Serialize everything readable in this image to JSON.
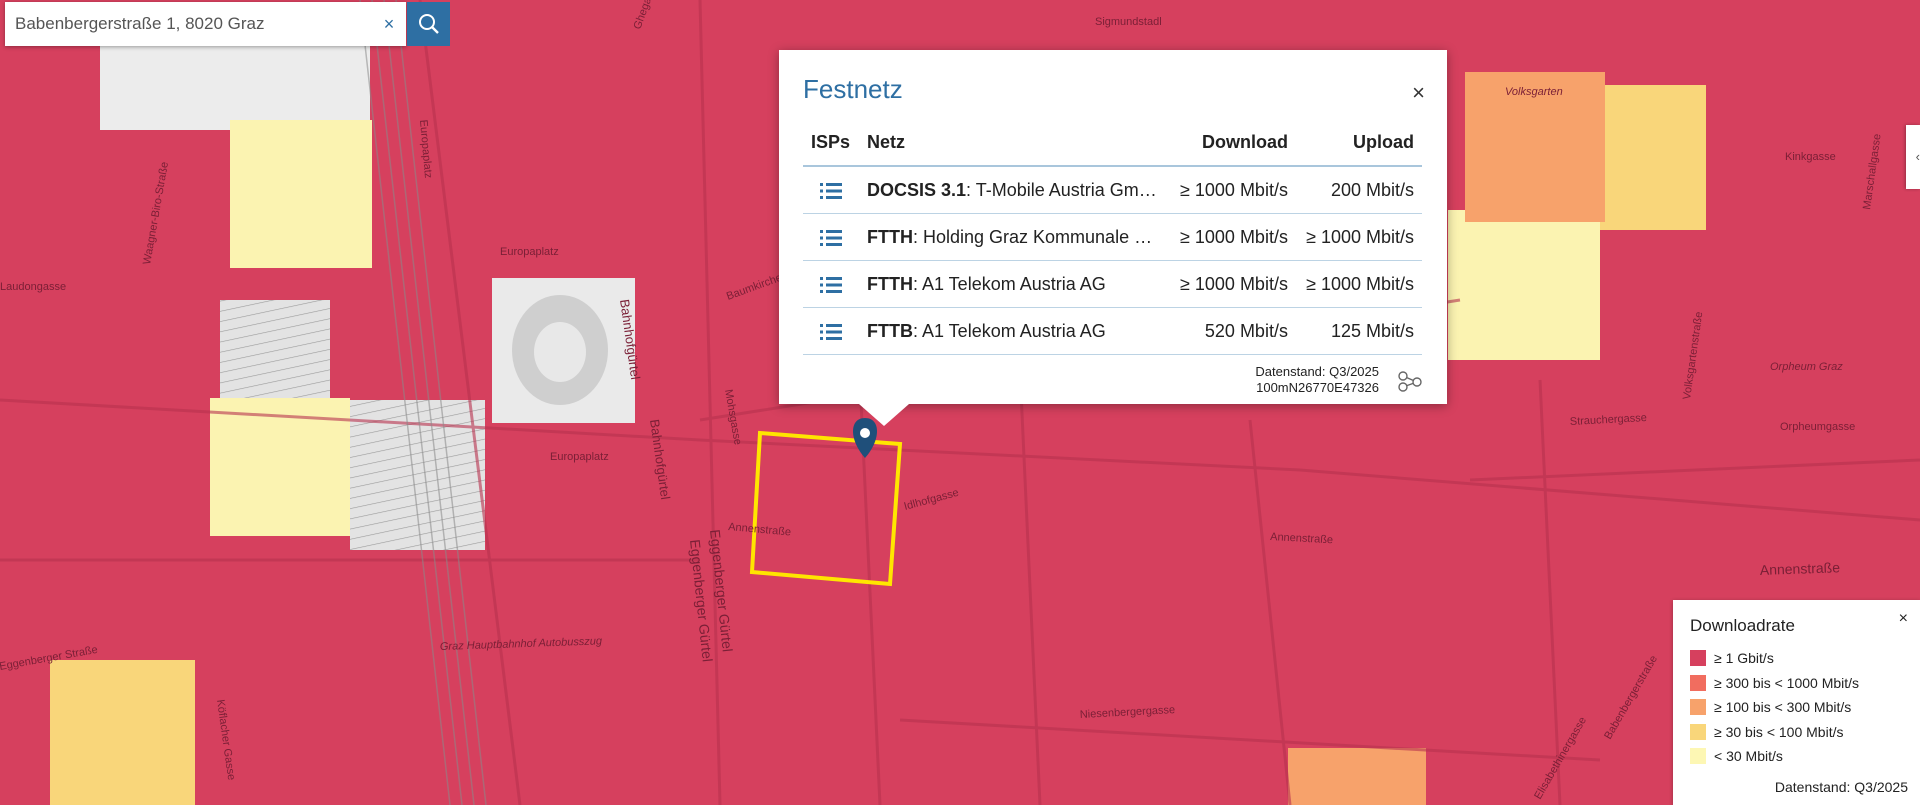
{
  "search": {
    "value": "Babenbergerstraße 1, 8020 Graz",
    "clear_label": "×"
  },
  "map": {
    "street_labels": [
      "Annenstraße",
      "Annenstraße",
      "Annenstraße",
      "Bahnhofgürtel",
      "Bahnhofgürtel",
      "Eggenberger Gürtel",
      "Eggenberger Gürtel",
      "Europaplatz",
      "Europaplatz",
      "Europaplatz",
      "Niesenbergergasse",
      "Volksgartenstraße",
      "Strauchergasse",
      "Orpheumgasse",
      "Eggenberger Straße",
      "Waagner-Biro-Straße",
      "Laudongasse",
      "Sigmundstadl",
      "Kinkgasse",
      "Marschallgasse",
      "Babenbergerstraße",
      "Graz Hauptbahnhof Autobusszug",
      "Orpheum Graz",
      "Volksgarten",
      "Köflacher Gasse",
      "Elisabethinergasse",
      "Idlhofgasse",
      "Mohsgasse",
      "Baumkirchergasse",
      "Ghegagasse"
    ]
  },
  "popup": {
    "title": "Festnetz",
    "close_label": "×",
    "columns": [
      "ISPs",
      "Netz",
      "Download",
      "Upload"
    ],
    "rows": [
      {
        "tech": "DOCSIS 3.1",
        "provider": ": T-Mobile Austria Gm…",
        "download": "≥ 1000 Mbit/s",
        "upload": "200 Mbit/s"
      },
      {
        "tech": "FTTH",
        "provider": ": Holding Graz Kommunale …",
        "download": "≥ 1000 Mbit/s",
        "upload": "≥ 1000 Mbit/s"
      },
      {
        "tech": "FTTH",
        "provider": ": A1 Telekom Austria AG",
        "download": "≥ 1000 Mbit/s",
        "upload": "≥ 1000 Mbit/s"
      },
      {
        "tech": "FTTB",
        "provider": ": A1 Telekom Austria AG",
        "download": "520 Mbit/s",
        "upload": "125 Mbit/s"
      }
    ],
    "datenstand": "Datenstand: Q3/2025",
    "raster_id": "100mN26770E47326"
  },
  "legend": {
    "title": "Downloadrate",
    "close_label": "×",
    "items": [
      {
        "label": "≥ 1 Gbit/s",
        "color": "#d6405e"
      },
      {
        "label": "≥ 300 bis < 1000 Mbit/s",
        "color": "#f16d5f"
      },
      {
        "label": "≥ 100 bis < 300 Mbit/s",
        "color": "#f7a26b"
      },
      {
        "label": "≥ 30 bis < 100 Mbit/s",
        "color": "#f9d67a"
      },
      {
        "label": "< 30 Mbit/s",
        "color": "#fdf7b4"
      }
    ],
    "footer": "Datenstand: Q3/2025"
  },
  "colors": {
    "accent": "#2e6fa3",
    "selection": "#ffe600",
    "tile_gbit": "#d6405e",
    "tile_300": "#f16d5f",
    "tile_100": "#f7a26b",
    "tile_30": "#f9d67a",
    "tile_low": "#fdf7b4"
  }
}
